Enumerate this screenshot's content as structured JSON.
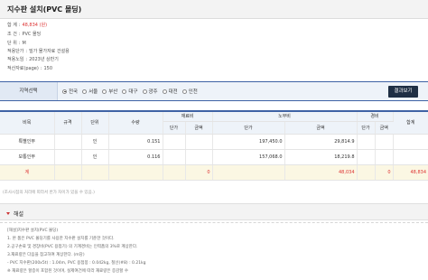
{
  "page": {
    "title": "지수판 설치(PVC 몰딩)"
  },
  "info": [
    {
      "key": "합 계",
      "value": "48,834 (원)",
      "highlight": true
    },
    {
      "key": "조 건",
      "value": "PVC 몰딩",
      "highlight": false
    },
    {
      "key": "단 위",
      "value": "M",
      "highlight": false
    },
    {
      "key": "적용단가",
      "value": "밀가 물가자료 건설용",
      "highlight": false
    },
    {
      "key": "적용노임",
      "value": "2023년 상반기",
      "highlight": false
    },
    {
      "key": "적산자료(page)",
      "value": "150",
      "highlight": false
    }
  ],
  "region": {
    "label": "지역선택",
    "options": [
      "전국",
      "서울",
      "부산",
      "대구",
      "광주",
      "대전",
      "인천"
    ],
    "selected": "전국",
    "button_label": "결과보기"
  },
  "table": {
    "headers": {
      "name": "비목",
      "spec": "규격",
      "unit": "단위",
      "qty": "수량",
      "material": "재료비",
      "labor": "노무비",
      "expense": "경비",
      "total": "합계",
      "unit_price": "단가",
      "amount": "금액"
    },
    "rows": [
      {
        "name": "특별인부",
        "spec": "",
        "unit": "인",
        "qty": "0.151",
        "mat_price": "",
        "mat_amount": "",
        "lab_price": "197,450.0",
        "lab_amount": "29,814.9",
        "exp_price": "",
        "exp_amount": "",
        "total": ""
      },
      {
        "name": "보통인부",
        "spec": "",
        "unit": "인",
        "qty": "0.116",
        "mat_price": "",
        "mat_amount": "",
        "lab_price": "157,068.0",
        "lab_amount": "18,219.8",
        "exp_price": "",
        "exp_amount": "",
        "total": ""
      }
    ],
    "total_row": {
      "name": "계",
      "mat_amount": "0",
      "lab_amount": "48,034",
      "exp_amount": "0",
      "total": "48,834"
    }
  },
  "note": "(조사시점의 처리에 따라서 반가 차이가 있을 수 있음.)",
  "description": {
    "title": "해설",
    "lines": [
      "[해설]지수판 설치(PVC 몰딩)",
      "1. 본 품은 PVC 몰딩기를 사용한 지수판 설치를 기준한 것이다.",
      "2.공구손료 및 경장비(PVC 용접기) 의 기계경비는 인력품의 3%로 계상한다.",
      "3.재료량은 다음을 참고하여 계상한다. (m당)",
      "- PVC 지수판(200x5t) : 1.04m, PVC 용접봉 : 0.042kg, 철선(#8) : 0.21kg",
      "※ 재료량은 할증이 포함된 것이며, 실제여건에 따라 재료량은 증감할 수"
    ]
  },
  "colors": {
    "accent": "#3f63a5",
    "button": "#1f2f44",
    "price_red": "#dd3333",
    "total_row_bg": "#fbf7e3"
  }
}
